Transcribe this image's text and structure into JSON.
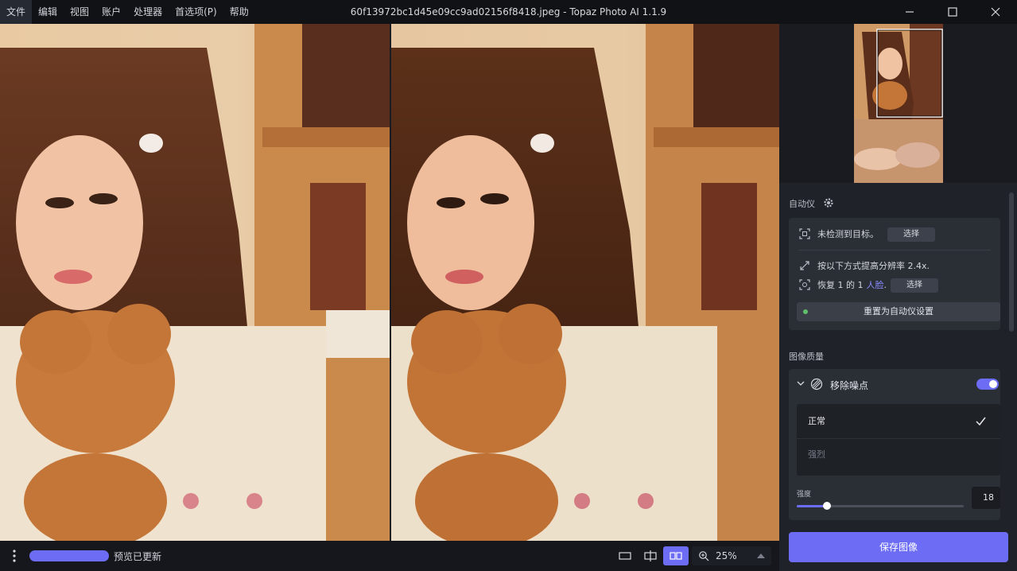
{
  "menu": [
    {
      "label": "文件",
      "active": true
    },
    {
      "label": "编辑"
    },
    {
      "label": "视图"
    },
    {
      "label": "账户"
    },
    {
      "label": "处理器"
    },
    {
      "label": "首选项(P)"
    },
    {
      "label": "帮助"
    }
  ],
  "window": {
    "title": "60f13972bc1d45e09cc9ad02156f8418.jpeg - Topaz Photo AI 1.1.9"
  },
  "bottombar": {
    "status": "预览已更新",
    "zoom": "25%",
    "progress_percent": 100
  },
  "autopilot": {
    "title": "自动仪",
    "no_target": "未检测到目标。",
    "select_label": "选择",
    "upscale_text": "按以下方式提高分辨率 2.4x.",
    "face_prefix": "恢复 1 的 1",
    "face_link": "人脸",
    "face_suffix": ".",
    "face_select_label": "选择",
    "reset_label": "重置为自动仪设置"
  },
  "quality": {
    "title": "图像质量",
    "denoise": {
      "label": "移除噪点",
      "enabled": true,
      "options": [
        {
          "label": "正常",
          "selected": true
        },
        {
          "label": "强烈",
          "selected": false
        }
      ],
      "strength_label": "强度",
      "strength_value": "18",
      "strength_fraction": 0.18
    }
  },
  "save_label": "保存图像",
  "colors": {
    "accent": "#6d6cf5",
    "link": "#8a8cff",
    "panel": "#1f2228",
    "card": "#2a2e35"
  }
}
